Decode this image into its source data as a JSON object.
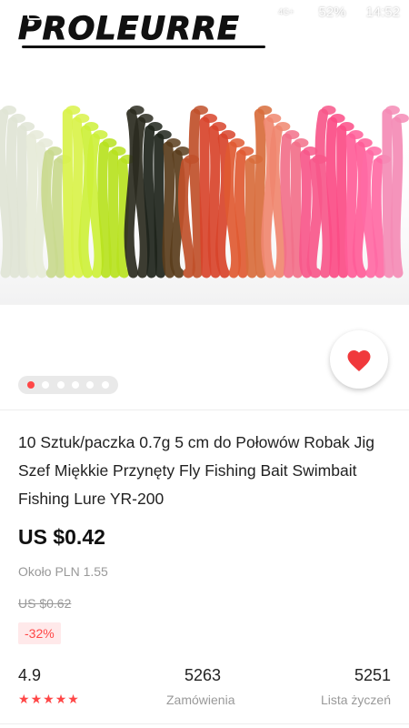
{
  "status_bar": {
    "network": "4G+",
    "battery": "52%",
    "time": "14:52"
  },
  "brand": {
    "logo_text": "PROLEURRE"
  },
  "action_bar": {
    "icons": [
      "back-arrow-icon",
      "search-icon",
      "cart-icon",
      "share-icon",
      "more-vert-icon"
    ]
  },
  "gallery": {
    "image_count": 6,
    "active_index": 0
  },
  "product": {
    "title": "10 Sztuk/paczka 0.7g 5 cm do Połowów Robak Jig Szef Miękkie Przynęty Fly Fishing Bait Swimbait Fishing Lure YR-200",
    "price": "US $0.42",
    "approx_price": "Około PLN 1.55",
    "original_price": "US $0.62",
    "discount": "-32%"
  },
  "stats": {
    "rating": "4.9",
    "stars": 5,
    "orders_value": "5263",
    "orders_label": "Zamówienia",
    "wishlist_value": "5251",
    "wishlist_label": "Lista życzeń"
  },
  "colors": {
    "accent": "#ff4747",
    "text": "#222222",
    "muted": "#999999"
  }
}
